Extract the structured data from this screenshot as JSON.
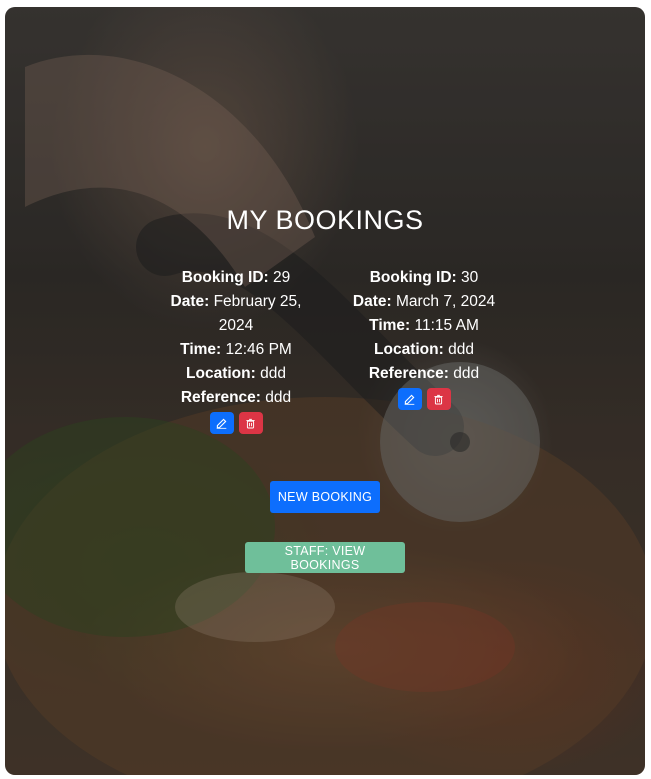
{
  "page": {
    "title": "MY BOOKINGS"
  },
  "bookings": [
    {
      "id_label": "Booking ID:",
      "id": "29",
      "date_label": "Date:",
      "date": "February 25, 2024",
      "time_label": "Time:",
      "time": "12:46 PM",
      "location_label": "Location:",
      "location": "ddd",
      "reference_label": "Reference:",
      "reference": "ddd"
    },
    {
      "id_label": "Booking ID:",
      "id": "30",
      "date_label": "Date:",
      "date": "March 7, 2024",
      "time_label": "Time:",
      "time": "11:15 AM",
      "location_label": "Location:",
      "location": "ddd",
      "reference_label": "Reference:",
      "reference": "ddd"
    }
  ],
  "actions": {
    "new_booking_label": "NEW BOOKING",
    "staff_view_label": "STAFF: VIEW BOOKINGS"
  },
  "icons": {
    "edit": "pencil-square-icon",
    "delete": "trash-icon"
  },
  "colors": {
    "primary": "#0d6efd",
    "danger": "#dc3545",
    "success_light": "#6fbf9a"
  }
}
